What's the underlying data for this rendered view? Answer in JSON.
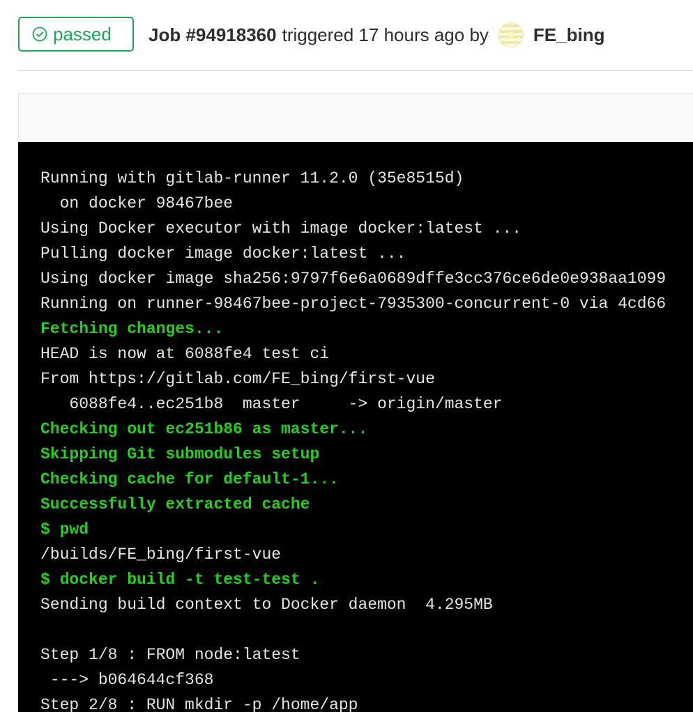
{
  "header": {
    "status": "passed",
    "status_color": "#1aaa55",
    "status_icon": "check-circle-icon",
    "job_title": "Job #94918360",
    "triggered_text": "triggered 17 hours ago by",
    "user_name": "FE_bing"
  },
  "log": {
    "lines": [
      {
        "text": "Running with gitlab-runner 11.2.0 (35e8515d)",
        "style": "normal"
      },
      {
        "text": "  on docker 98467bee",
        "style": "normal"
      },
      {
        "text": "Using Docker executor with image docker:latest ...",
        "style": "normal"
      },
      {
        "text": "Pulling docker image docker:latest ...",
        "style": "normal"
      },
      {
        "text": "Using docker image sha256:9797f6e6a0689dffe3cc376ce6de0e938aa1099",
        "style": "normal"
      },
      {
        "text": "Running on runner-98467bee-project-7935300-concurrent-0 via 4cd66",
        "style": "normal"
      },
      {
        "text": "Fetching changes...",
        "style": "green"
      },
      {
        "text": "HEAD is now at 6088fe4 test ci",
        "style": "normal"
      },
      {
        "text": "From https://gitlab.com/FE_bing/first-vue",
        "style": "normal"
      },
      {
        "text": "   6088fe4..ec251b8  master     -> origin/master",
        "style": "normal"
      },
      {
        "text": "Checking out ec251b86 as master...",
        "style": "green"
      },
      {
        "text": "Skipping Git submodules setup",
        "style": "green"
      },
      {
        "text": "Checking cache for default-1...",
        "style": "green"
      },
      {
        "text": "Successfully extracted cache",
        "style": "green"
      },
      {
        "text": "$ pwd",
        "style": "green"
      },
      {
        "text": "/builds/FE_bing/first-vue",
        "style": "normal"
      },
      {
        "text": "$ docker build -t test-test .",
        "style": "green"
      },
      {
        "text": "Sending build context to Docker daemon  4.295MB",
        "style": "normal"
      },
      {
        "text": "",
        "style": "normal"
      },
      {
        "text": "Step 1/8 : FROM node:latest",
        "style": "normal"
      },
      {
        "text": " ---> b064644cf368",
        "style": "normal"
      },
      {
        "text": "Step 2/8 : RUN mkdir -p /home/app",
        "style": "normal"
      }
    ]
  }
}
